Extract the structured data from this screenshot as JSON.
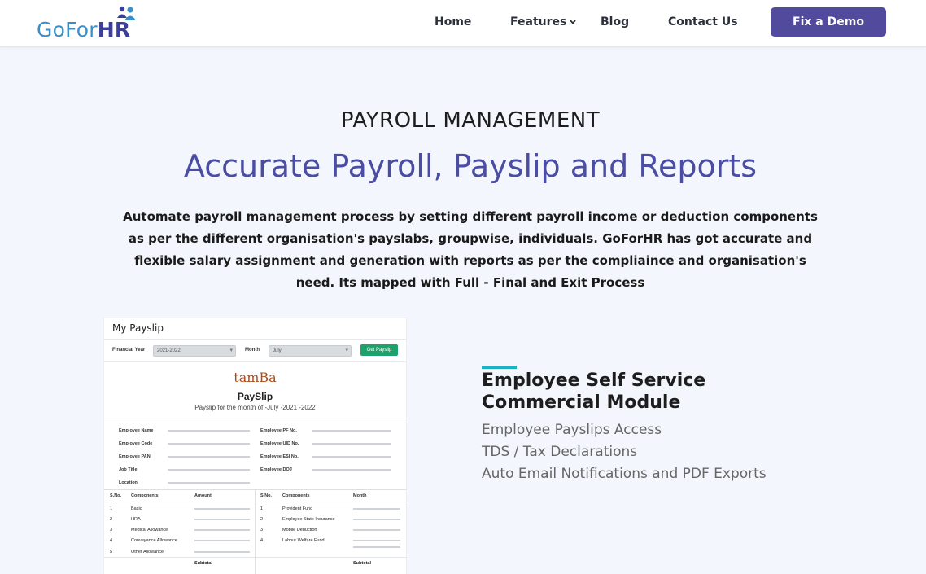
{
  "brand": {
    "logo_prefix": "GoFor",
    "logo_suffix": "HR",
    "colors": {
      "primary": "#514a9d",
      "logo_blue": "#3a8fc7",
      "accent": "#19b4c4",
      "headline": "#4b4da3"
    }
  },
  "nav": {
    "items": [
      {
        "label": "Home"
      },
      {
        "label": "Features",
        "icon": "chevron-down-icon"
      },
      {
        "label": "Blog"
      },
      {
        "label": "Contact Us"
      }
    ],
    "cta_label": "Fix a Demo"
  },
  "hero": {
    "kicker": "PAYROLL MANAGEMENT",
    "headline": "Accurate Payroll, Payslip and Reports",
    "intro": "Automate payroll management process by setting different payroll income or deduction components as per the different organisation's payslabs, groupwise, individuals. GoForHR has got accurate and flexible salary assignment and generation with reports as per the compliaince and organisation's need. Its mapped with Full - Final and Exit Process"
  },
  "payslip_preview": {
    "header": "My Payslip",
    "financial_year_label": "Financial Year",
    "financial_year_value": "2021-2022",
    "month_label": "Month",
    "month_value": "July",
    "get_button": "Get Payslip",
    "company": "tamBa",
    "title": "PaySlip",
    "subtitle": "Payslip for the month of -July -2021 -2022",
    "left_fields": [
      "Employee Name",
      "Employee Code",
      "Employee PAN",
      "Job Title",
      "Location"
    ],
    "right_fields": [
      "Employee PF No.",
      "Employee UID No.",
      "Employee ESI No.",
      "Employee DOJ"
    ],
    "earnings_headers": [
      "S.No.",
      "Components",
      "Amount"
    ],
    "deduction_headers": [
      "S.No.",
      "Components",
      "Month"
    ],
    "earnings": [
      {
        "no": "1",
        "name": "Basic"
      },
      {
        "no": "2",
        "name": "HRA"
      },
      {
        "no": "3",
        "name": "Medical Allowance"
      },
      {
        "no": "4",
        "name": "Conveyance Allowance"
      },
      {
        "no": "5",
        "name": "Other Allowance"
      }
    ],
    "deductions": [
      {
        "no": "1",
        "name": "Provident Fund"
      },
      {
        "no": "2",
        "name": "Employee State Insurance"
      },
      {
        "no": "3",
        "name": "Mobile Deduction"
      },
      {
        "no": "4",
        "name": "Labour Welfare Fund"
      }
    ],
    "subtotal_label": "Subtotal"
  },
  "feature": {
    "title": "Employee Self Service Commercial Module",
    "items": [
      "Employee Payslips Access",
      "TDS / Tax Declarations",
      "Auto Email Notifications and PDF Exports"
    ]
  }
}
